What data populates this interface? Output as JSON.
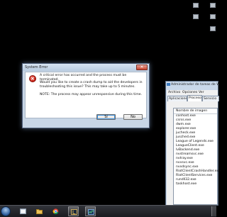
{
  "error_dialog": {
    "title": "System Error",
    "close_glyph": "✕",
    "icon": "error-icon",
    "message_main": "A critical error has occurred and the process must be terminated.",
    "message_dump": "Would you like to create a crash dump to aid the developers in troubleshooting this issue? This may take up to 5 minutes.",
    "message_note": "NOTE: The process may appear unresponsive during this time.",
    "yes_label": "Sí",
    "no_label": "No"
  },
  "task_manager": {
    "title": "Administrador de tareas de W",
    "menu": [
      "Archivo",
      "Opciones",
      "Ver"
    ],
    "tabs": [
      "Aplicaciones",
      "Procesos",
      "Servicio"
    ],
    "active_tab": "Procesos",
    "column_header": "Nombre de imagen",
    "processes": [
      "conhost.exe",
      "csrss.exe",
      "dwm.exe",
      "explorer.exe",
      "jucheck.exe",
      "jusched.exe",
      "League of Legends.exe",
      "LeagueClient.exe",
      "lvBackend.exe",
      "nvstreamsvc.exe",
      "nvtray.exe",
      "nvvsvc.exe",
      "nvxdsync.exe",
      "RiotClientCrashHandler.exe",
      "RiotClientServices.exe",
      "rundll32.exe",
      "taskhost.exe"
    ]
  },
  "taskbar": {
    "items": [
      "start-orb",
      "explorer-icon",
      "folder-icon",
      "chrome-icon",
      "league-client-icon",
      "task-manager-icon"
    ]
  }
}
